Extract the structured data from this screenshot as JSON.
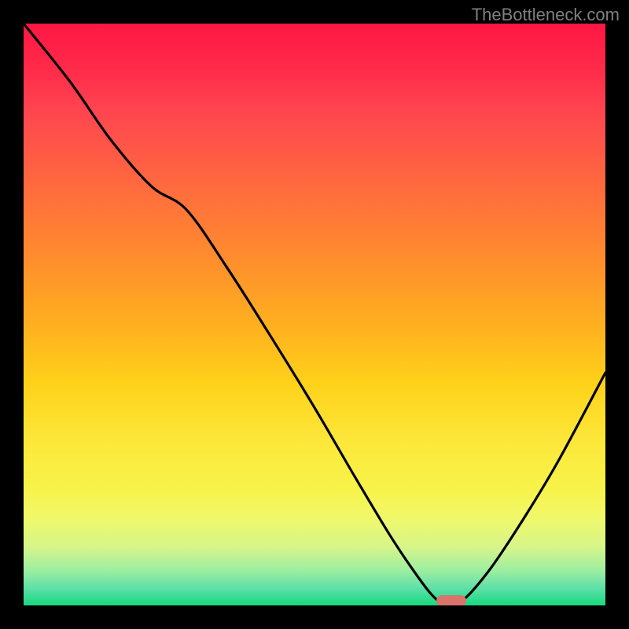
{
  "watermark": "TheBottleneck.com",
  "chart_data": {
    "type": "line",
    "title": "",
    "xlabel": "",
    "ylabel": "",
    "xlim": [
      0,
      100
    ],
    "ylim": [
      0,
      100
    ],
    "series": [
      {
        "name": "curve",
        "x": [
          0,
          8,
          15,
          22,
          28,
          35,
          42,
          50,
          57,
          63,
          67,
          70,
          72,
          75,
          80,
          86,
          92,
          100
        ],
        "y": [
          100,
          90,
          80,
          72,
          68,
          58,
          47,
          34,
          22,
          12,
          6,
          2,
          0.5,
          0.5,
          6,
          15,
          25,
          40
        ]
      }
    ],
    "marker": {
      "x": 73.5,
      "y": 0.8
    },
    "colors": {
      "curve": "#000000",
      "marker": "#d9736b",
      "gradient_top": "#ff1744",
      "gradient_mid": "#ffd21a",
      "gradient_bottom": "#16d97f"
    }
  }
}
